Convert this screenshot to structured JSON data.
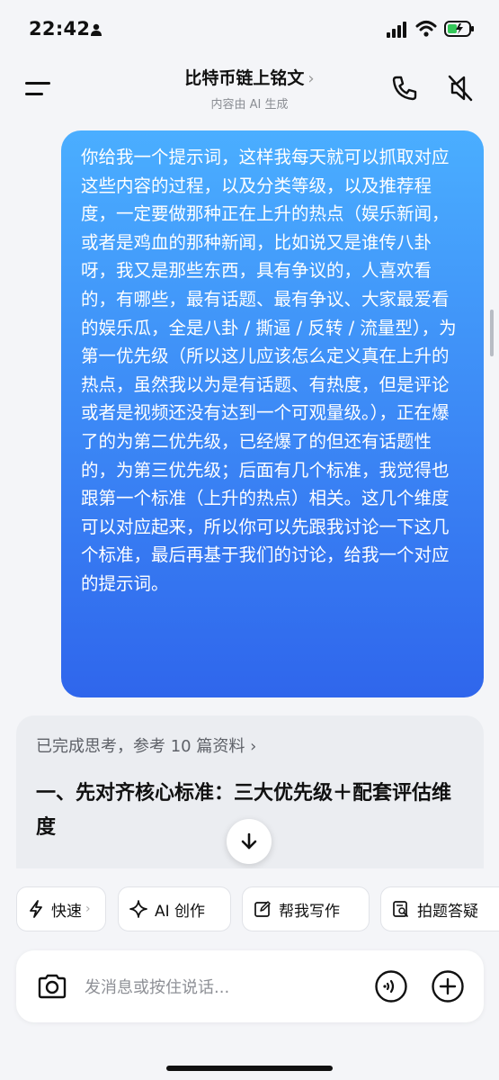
{
  "status_bar": {
    "time": "22:42"
  },
  "header": {
    "title": "比特币链上铭文",
    "subtitle": "内容由 AI 生成"
  },
  "user_message": "你给我一个提示词，这样我每天就可以抓取对应这些内容的过程，以及分类等级，以及推荐程度，一定要做那种正在上升的热点（娱乐新闻，或者是鸡血的那种新闻，比如说又是谁传八卦呀，我又是那些东西，具有争议的，人喜欢看的，有哪些，最有话题、最有争议、大家最爱看的娱乐瓜，全是八卦 / 撕逼 / 反转 / 流量型），为第一优先级（所以这儿应该怎么定义真在上升的热点，虽然我以为是有话题、有热度，但是评论或者是视频还没有达到一个可观量级。），正在爆了的为第二优先级，已经爆了的但还有话题性的，为第三优先级；后面有几个标准，我觉得也跟第一个标准（上升的热点）相关。这几个维度可以对应起来，所以你可以先跟我讨论一下这几个标准，最后再基于我们的讨论，给我一个对应的提示词。",
  "assistant": {
    "thinking_status": "已完成思考，参考 10 篇资料 ›",
    "heading": "一、先对齐核心标准：三大优先级＋配套评估维度"
  },
  "quick_actions": [
    {
      "label": "快速",
      "icon": "lightning-icon"
    },
    {
      "label": "AI 创作",
      "icon": "sparkle-icon"
    },
    {
      "label": "帮我写作",
      "icon": "edit-icon"
    },
    {
      "label": "拍题答疑",
      "icon": "scan-question-icon"
    }
  ],
  "input": {
    "placeholder": "发消息或按住说话..."
  },
  "colors": {
    "bubble_top": "#4aaeff",
    "bubble_bottom": "#2f66ec",
    "background": "#f4f5f8"
  }
}
